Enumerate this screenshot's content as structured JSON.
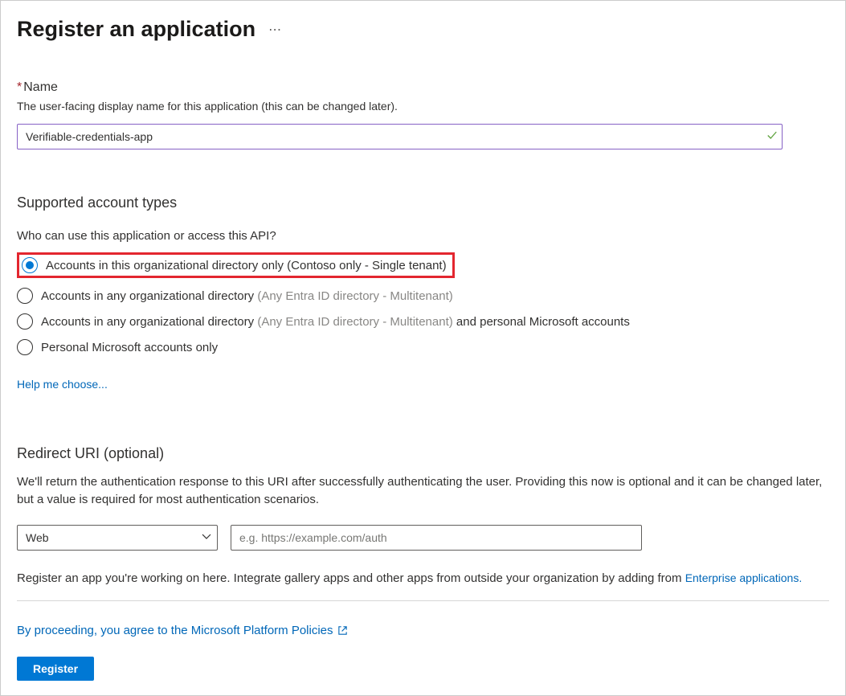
{
  "header": {
    "title": "Register an application"
  },
  "nameField": {
    "label": "Name",
    "description": "The user-facing display name for this application (this can be changed later).",
    "value": "Verifiable-credentials-app"
  },
  "accountTypes": {
    "heading": "Supported account types",
    "subtext": "Who can use this application or access this API?",
    "options": [
      {
        "label": "Accounts in this organizational directory only (Contoso only - Single tenant)",
        "selected": true,
        "highlighted": true
      },
      {
        "label": "Accounts in any organizational directory",
        "suffix_gray": " (Any Entra ID directory - Multitenant)",
        "suffix_dark": ""
      },
      {
        "label": "Accounts in any organizational directory",
        "suffix_gray": " (Any Entra ID directory - Multitenant) ",
        "suffix_dark": " and personal Microsoft accounts"
      },
      {
        "label": "Personal Microsoft accounts only"
      }
    ],
    "helpLink": "Help me choose..."
  },
  "redirectUri": {
    "heading": "Redirect URI (optional)",
    "description": "We'll return the authentication response to this URI after successfully authenticating the user. Providing this now is optional and it can be changed later, but a value is required for most authentication scenarios.",
    "platformValue": "Web",
    "uriPlaceholder": "e.g. https://example.com/auth"
  },
  "galleryNote": {
    "prefix": "Register an app you're working on here. Integrate gallery apps and other apps from outside your organization by adding from ",
    "linkText": "Enterprise applications."
  },
  "footer": {
    "policyText": "By proceeding, you agree to the Microsoft Platform Policies",
    "registerLabel": "Register"
  }
}
